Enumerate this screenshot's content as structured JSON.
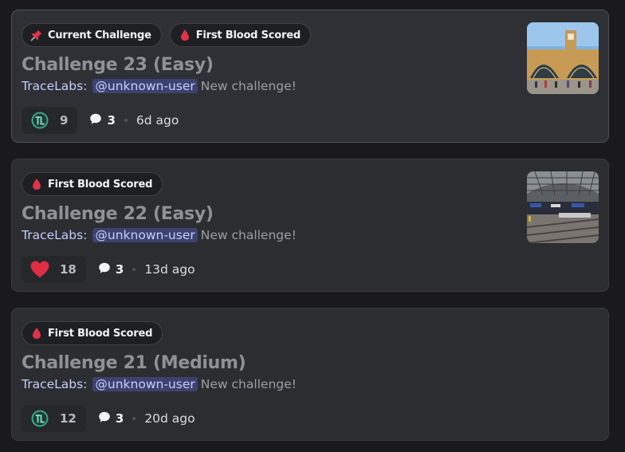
{
  "threads": [
    {
      "tags": [
        {
          "label": "Current Challenge",
          "icon": "pushpin-icon"
        },
        {
          "label": "First Blood Scored",
          "icon": "blood-drop-icon"
        }
      ],
      "title": "Challenge 23 (Easy)",
      "author": "TraceLabs:",
      "mention": "@unknown-user",
      "message": "New challenge!",
      "reaction_icon": "tracelabs-icon",
      "reaction_count": "9",
      "reply_count": "3",
      "age": "6d ago"
    },
    {
      "tags": [
        {
          "label": "First Blood Scored",
          "icon": "blood-drop-icon"
        }
      ],
      "title": "Challenge 22 (Easy)",
      "author": "TraceLabs:",
      "mention": "@unknown-user",
      "message": "New challenge!",
      "reaction_icon": "heart-icon",
      "reaction_count": "18",
      "reply_count": "3",
      "age": "13d ago"
    },
    {
      "tags": [
        {
          "label": "First Blood Scored",
          "icon": "blood-drop-icon"
        }
      ],
      "title": "Challenge 21 (Medium)",
      "author": "TraceLabs:",
      "mention": "@unknown-user",
      "message": "New challenge!",
      "reaction_icon": "tracelabs-icon",
      "reaction_count": "12",
      "reply_count": "3",
      "age": "20d ago"
    }
  ],
  "colors": {
    "background": "#1a1a1e",
    "card": "#2b2d31",
    "mention_bg": "#3c4270",
    "mention_text": "#c9cdfb",
    "blood": "#e0324a",
    "heart": "#dd2e44",
    "tracelabs_teal": "#3fa58b"
  }
}
